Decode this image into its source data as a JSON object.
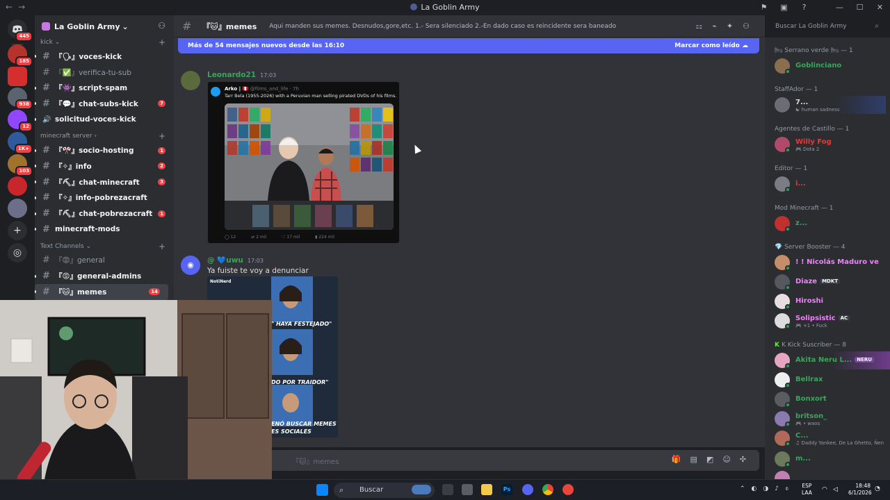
{
  "titlebar": {
    "title": "La Goblin Army",
    "back": "←",
    "forward": "→",
    "icons": [
      "inbox-icon",
      "screen-icon",
      "help-icon"
    ],
    "minimize": "—",
    "maximize": "☐",
    "close": "✕"
  },
  "guild_rail": {
    "home_badge": "445",
    "guilds": [
      {
        "badge": "185",
        "color": "#b4342c"
      },
      {
        "badge": "",
        "color": "#d42e2e"
      },
      {
        "badge": "938",
        "color": "#5b6270"
      },
      {
        "badge": "12",
        "color": "#9146ff"
      },
      {
        "badge": "1K+",
        "color": "#2f5b9c"
      },
      {
        "badge": "103",
        "color": "#a0722d"
      },
      {
        "badge": "",
        "color": "#c7262b"
      },
      {
        "badge": "",
        "color": "#6d6e8a"
      }
    ]
  },
  "server": {
    "name": "La Goblin Army",
    "chevron": "⌄"
  },
  "channels": {
    "cat_kick": "kick",
    "kick": [
      {
        "name": "『🗣』voces-kick",
        "badge": "",
        "unread": true
      },
      {
        "name": "『✅』verifica-tu-sub",
        "badge": "",
        "unread": false
      },
      {
        "name": "『👾』script-spam",
        "badge": "",
        "unread": true
      },
      {
        "name": "『💬』chat-subs-kick",
        "badge": "7",
        "unread": true
      },
      {
        "name": "solicitud-voces-kick",
        "badge": "",
        "unread": true
      }
    ],
    "cat_minecraft": "minecraft server",
    "minecraft": [
      {
        "name": "『🎌』socio-hosting",
        "badge": "1",
        "unread": true
      },
      {
        "name": "『✧』info",
        "badge": "2",
        "unread": true
      },
      {
        "name": "『⛏』chat-minecraft",
        "badge": "3",
        "unread": true
      },
      {
        "name": "『✧』info-pobrezacraft",
        "badge": "",
        "unread": true
      },
      {
        "name": "『⛏』chat-pobrezacraft",
        "badge": "1",
        "unread": true
      },
      {
        "name": "minecraft-mods",
        "badge": "",
        "unread": true
      }
    ],
    "cat_text": "Text Channels",
    "text": [
      {
        "name": "『😡』general",
        "badge": "",
        "unread": false
      },
      {
        "name": "『😡』general-admins",
        "badge": "",
        "unread": true
      },
      {
        "name": "『🐱』memes",
        "badge": "14",
        "unread": true
      }
    ]
  },
  "header": {
    "channel": "『🐱』memes",
    "topic": "Aqui manden sus memes. Desnudos,gore,etc. 1.- Sera silenciado 2.-En dado caso es reincidente sera baneado",
    "search_placeholder": "Buscar La Goblin Army"
  },
  "chat": {
    "new_messages": "Más de 54 mensajes nuevos desde las 16:10",
    "mark_read": "Marcar como leído",
    "messages": [
      {
        "author": "Leonardo21",
        "time": "17:03",
        "author_color": "#3ba55c",
        "embed": {
          "handle": "Arko | 🇵🇪",
          "meta": "@films_and_life · 7h",
          "text": "Tarr Bela (1955-2026) with a Peruvian man selling pirated DVDs of his films.",
          "stats": [
            "12",
            "2 mil",
            "17 mil",
            "224 mil"
          ]
        }
      },
      {
        "author": "@ 💙uwu",
        "time": "17:03",
        "author_color": "#3ba55c",
        "text": "Ya fuiste te voy a denunciar",
        "meme_captions": [
          "NotiNerd",
          "\" HAYA FESTEJADO\"",
          "DO POR TRAIDOR\"",
          "ENÓ BUSCAR MEMES",
          "ES SOCIALES"
        ]
      }
    ]
  },
  "composer": {
    "placeholder": "『🐱』memes"
  },
  "members": {
    "groups": [
      {
        "title": "🛏 Serrano verde 🛏 — 1",
        "members": [
          {
            "name": "Goblinciano",
            "color": "#3ba55c",
            "sub": "",
            "tag": ""
          }
        ]
      },
      {
        "title": "StaffAdor — 1",
        "members": [
          {
            "name": "7...",
            "color": "#dbdee1",
            "sub": "☯ human sadness",
            "tag": ""
          }
        ]
      },
      {
        "title": "Agentes de Castillo — 1",
        "members": [
          {
            "name": "Willy Fog",
            "color": "#e03c3c",
            "sub": "🎮 Dota 2",
            "tag": ""
          }
        ]
      },
      {
        "title": "Editor — 1",
        "members": [
          {
            "name": "i...",
            "color": "#e03c3c",
            "sub": "",
            "tag": ""
          }
        ]
      },
      {
        "title": "Mod Minecraft — 1",
        "members": [
          {
            "name": "z...",
            "color": "#3ba55c",
            "sub": "",
            "tag": ""
          }
        ]
      },
      {
        "title": "💎 Server Booster — 4",
        "members": [
          {
            "name": "! ! Nicolás Maduro ve",
            "color": "#f47fff",
            "sub": "",
            "tag": ""
          },
          {
            "name": "Diaze",
            "color": "#f47fff",
            "sub": "",
            "tag": "MDKT"
          },
          {
            "name": "Hiroshi",
            "color": "#f47fff",
            "sub": "",
            "tag": ""
          },
          {
            "name": "Solipsistic",
            "color": "#f47fff",
            "sub": "🎮 +1 • Fuck",
            "tag": "AC"
          }
        ]
      },
      {
        "title": "K Kick Suscriber — 8",
        "members": [
          {
            "name": "Akita Neru L...",
            "color": "#3ba55c",
            "sub": "",
            "tag": "NERU"
          },
          {
            "name": "Bellrax",
            "color": "#3ba55c",
            "sub": "",
            "tag": ""
          },
          {
            "name": "Bonxort",
            "color": "#3ba55c",
            "sub": "",
            "tag": ""
          },
          {
            "name": "britson_",
            "color": "#3ba55c",
            "sub": "🎮 • waos",
            "tag": ""
          },
          {
            "name": "C...",
            "color": "#3ba55c",
            "sub": "♫ Daddy Yankee, De La Ghetto, Ñen",
            "tag": ""
          },
          {
            "name": "m...",
            "color": "#3ba55c",
            "sub": "",
            "tag": ""
          }
        ]
      }
    ]
  },
  "taskbar": {
    "search": "Buscar",
    "lang_1": "ESP",
    "lang_2": "LAA",
    "time": "18:48",
    "date": "6/1/2026"
  }
}
